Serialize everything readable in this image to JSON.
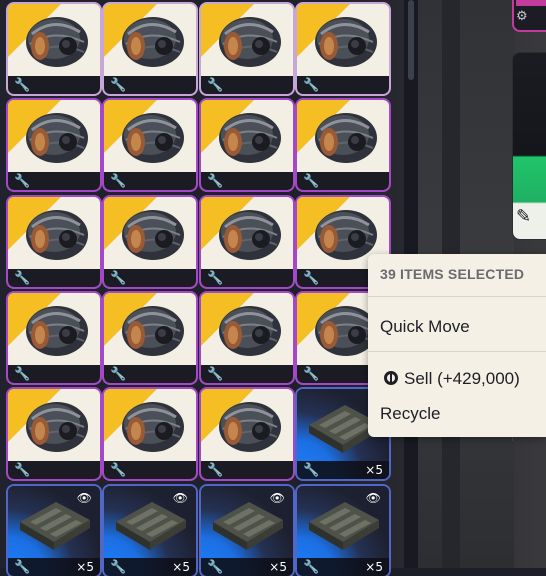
{
  "inventory": {
    "fuel_cell_tiles": 19,
    "tray_tiles": 5,
    "tile_badges": {
      "wrench": "wrench-icon",
      "eye": "eye-icon",
      "count": "×5"
    }
  },
  "context_menu": {
    "header": "39 ITEMS SELECTED",
    "quick_move": "Quick Move",
    "sell": "Sell (+429,000)",
    "recycle": "Recycle"
  },
  "colors": {
    "fuel_bg": "#f4efe4",
    "fuel_accent": "#f5be22",
    "tray_accent": "#1f80ff",
    "selected_ring": "#a447c8",
    "menu_bg": "#f4f0e6",
    "side_panel_green": "#20c46a",
    "side_panel_pink": "#c33c9c"
  }
}
